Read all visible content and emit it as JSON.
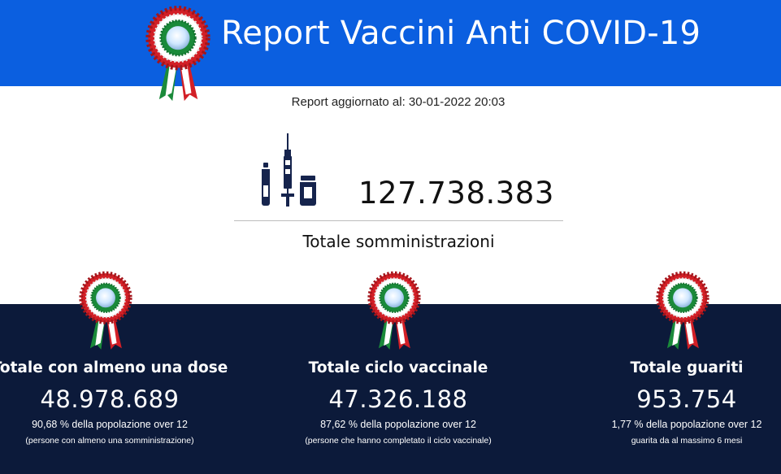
{
  "header": {
    "title": "Report Vaccini Anti COVID-19"
  },
  "report": {
    "updated": "Report aggiornato al: 30-01-2022 20:03",
    "total_value": "127.738.383",
    "total_label": "Totale somministrazioni"
  },
  "stats": [
    {
      "title": "Totale con almeno una dose",
      "value": "48.978.689",
      "percent": "90,68 % della popolazione over 12",
      "note": "(persone con almeno una somministrazione)"
    },
    {
      "title": "Totale ciclo vaccinale",
      "value": "47.326.188",
      "percent": "87,62 % della popolazione over 12",
      "note": "(persone che hanno completato il ciclo vaccinale)"
    },
    {
      "title": "Totale guariti",
      "value": "953.754",
      "percent": "1,77 % della popolazione over 12",
      "note": "guarita da al massimo 6 mesi"
    }
  ],
  "icons": {
    "header_emblem": "cockade-icon",
    "vaccine": "vaccine-icon",
    "stat_emblem": "cockade-icon"
  },
  "colors": {
    "header_bg": "#0b5fe0",
    "stats_bg": "#0c1a3a",
    "cockade_red": "#d21f26",
    "cockade_green": "#1a8a3a",
    "icon_navy": "#16244d"
  }
}
